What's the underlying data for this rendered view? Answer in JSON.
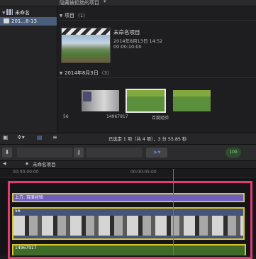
{
  "topbar": {
    "filter_label": "隐藏被拒绝的项目",
    "caret": "▾"
  },
  "library": {
    "root_label": "未命名",
    "event_label": "201...8-13"
  },
  "browser": {
    "projects_title": "项目",
    "projects_count": "(1)",
    "project": {
      "title": "未命名项目",
      "date": "2014年8月13日 14:52",
      "duration": "00:00:10:00"
    },
    "event_title": "2014年8月3日",
    "event_count": "(3)",
    "clips": [
      "56",
      "14967917",
      "百度经验"
    ]
  },
  "status": {
    "selection_info": "已选定 1 项（共 4 项），3 分 55.85 秒"
  },
  "timeline": {
    "project_name": "未命名项目",
    "ruler_ticks": [
      "00:00:00:00",
      "00:00:05:00"
    ],
    "title_clip_label": "上方: 百度经验",
    "video_clip_label": "56",
    "audio_clip_label": "14967917"
  },
  "toolbar": {
    "meter": "100"
  },
  "colors": {
    "selection": "#e33a73",
    "playhead": "#e0433f",
    "clip_outline": "#d9c230"
  }
}
